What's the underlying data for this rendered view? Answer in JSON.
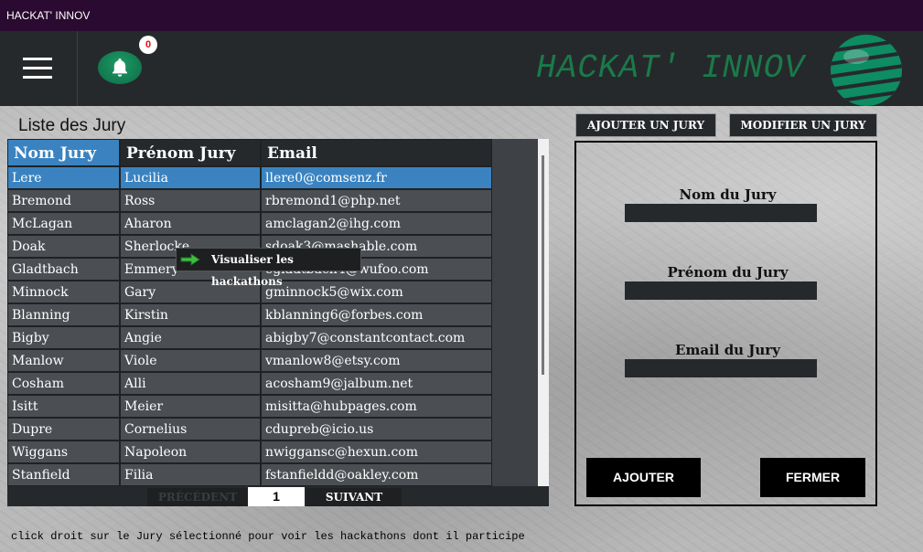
{
  "window": {
    "title": "HACKAT' INNOV"
  },
  "header": {
    "brand": "HACKAT' INNOV",
    "notification_count": "0"
  },
  "list": {
    "title": "Liste des Jury",
    "columns": [
      "Nom Jury",
      "Prénom Jury",
      "Email"
    ],
    "rows": [
      [
        "Lere",
        "Lucilia",
        "llere0@comsenz.fr"
      ],
      [
        "Bremond",
        "Ross",
        "rbremond1@php.net"
      ],
      [
        "McLagan",
        "Aharon",
        "amclagan2@ihg.com"
      ],
      [
        "Doak",
        "Sherlocke",
        "sdoak3@mashable.com"
      ],
      [
        "Gladtbach",
        "Emmery",
        "egladtbach4@wufoo.com"
      ],
      [
        "Minnock",
        "Gary",
        "gminnock5@wix.com"
      ],
      [
        "Blanning",
        "Kirstin",
        "kblanning6@forbes.com"
      ],
      [
        "Bigby",
        "Angie",
        "abigby7@constantcontact.com"
      ],
      [
        "Manlow",
        "Viole",
        "vmanlow8@etsy.com"
      ],
      [
        "Cosham",
        "Alli",
        "acosham9@jalbum.net"
      ],
      [
        "Isitt",
        "Meier",
        "misitta@hubpages.com"
      ],
      [
        "Dupre",
        "Cornelius",
        "cdupreb@icio.us"
      ],
      [
        "Wiggans",
        "Napoleon",
        "nwiggansc@hexun.com"
      ],
      [
        "Stanfield",
        "Filia",
        "fstanfieldd@oakley.com"
      ]
    ],
    "selected_row": 0
  },
  "context_menu": {
    "item": "Visualiser les hackathons"
  },
  "pager": {
    "prev": "PRÉCÉDENT",
    "page": "1",
    "next": "SUIVANT"
  },
  "hint": "click droit sur le Jury sélectionné pour voir les hackathons dont il participe",
  "actions": {
    "add_jury": "AJOUTER UN JURY",
    "edit_jury": "MODIFIER UN JURY"
  },
  "form": {
    "nom_label": "Nom du Jury",
    "prenom_label": "Prénom du Jury",
    "email_label": "Email du Jury",
    "nom_value": "",
    "prenom_value": "",
    "email_value": "",
    "submit": "AJOUTER",
    "close": "FERMER"
  },
  "colors": {
    "accent": "#3a83c0",
    "brand": "#1a7a4a",
    "titlebar": "#2a0a30",
    "dark": "#26292c"
  }
}
